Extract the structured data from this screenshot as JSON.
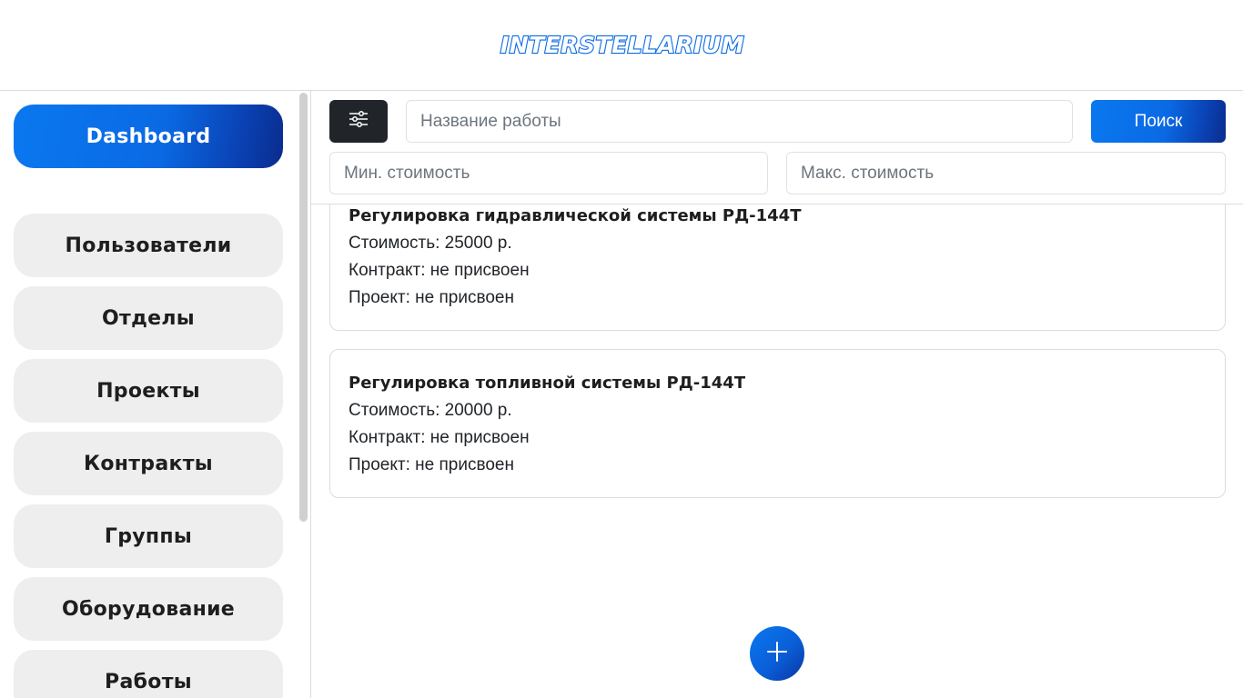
{
  "header": {
    "logo_text": "INTERSTELLARIUM"
  },
  "sidebar": {
    "items": [
      {
        "label": "Dashboard",
        "icon": null
      },
      {
        "label": "Пользователи"
      },
      {
        "label": "Отделы"
      },
      {
        "label": "Проекты"
      },
      {
        "label": "Контракты"
      },
      {
        "label": "Группы"
      },
      {
        "label": "Оборудование"
      },
      {
        "label": "Работы"
      }
    ]
  },
  "filters": {
    "filter_icon": "sliders-icon",
    "name_placeholder": "Название работы",
    "min_cost_placeholder": "Мин. стоимость",
    "max_cost_placeholder": "Макс. стоимость",
    "search_label": "Поиск"
  },
  "works": [
    {
      "title": "Регулировка гидравлической системы РД-144Т",
      "cost": "Стоимость: 25000 р.",
      "contract": "Контракт: не присвоен",
      "project": "Проект: не присвоен"
    },
    {
      "title": "Регулировка топливной системы РД-144Т",
      "cost": "Стоимость: 20000 р.",
      "contract": "Контракт: не присвоен",
      "project": "Проект: не присвоен"
    }
  ],
  "fab": {
    "icon": "plus-icon"
  },
  "colors": {
    "accent": "#0a6ae4",
    "accent_dark": "#0a2c8c",
    "nav_bg": "#eeeeee",
    "filter_button": "#212529"
  }
}
